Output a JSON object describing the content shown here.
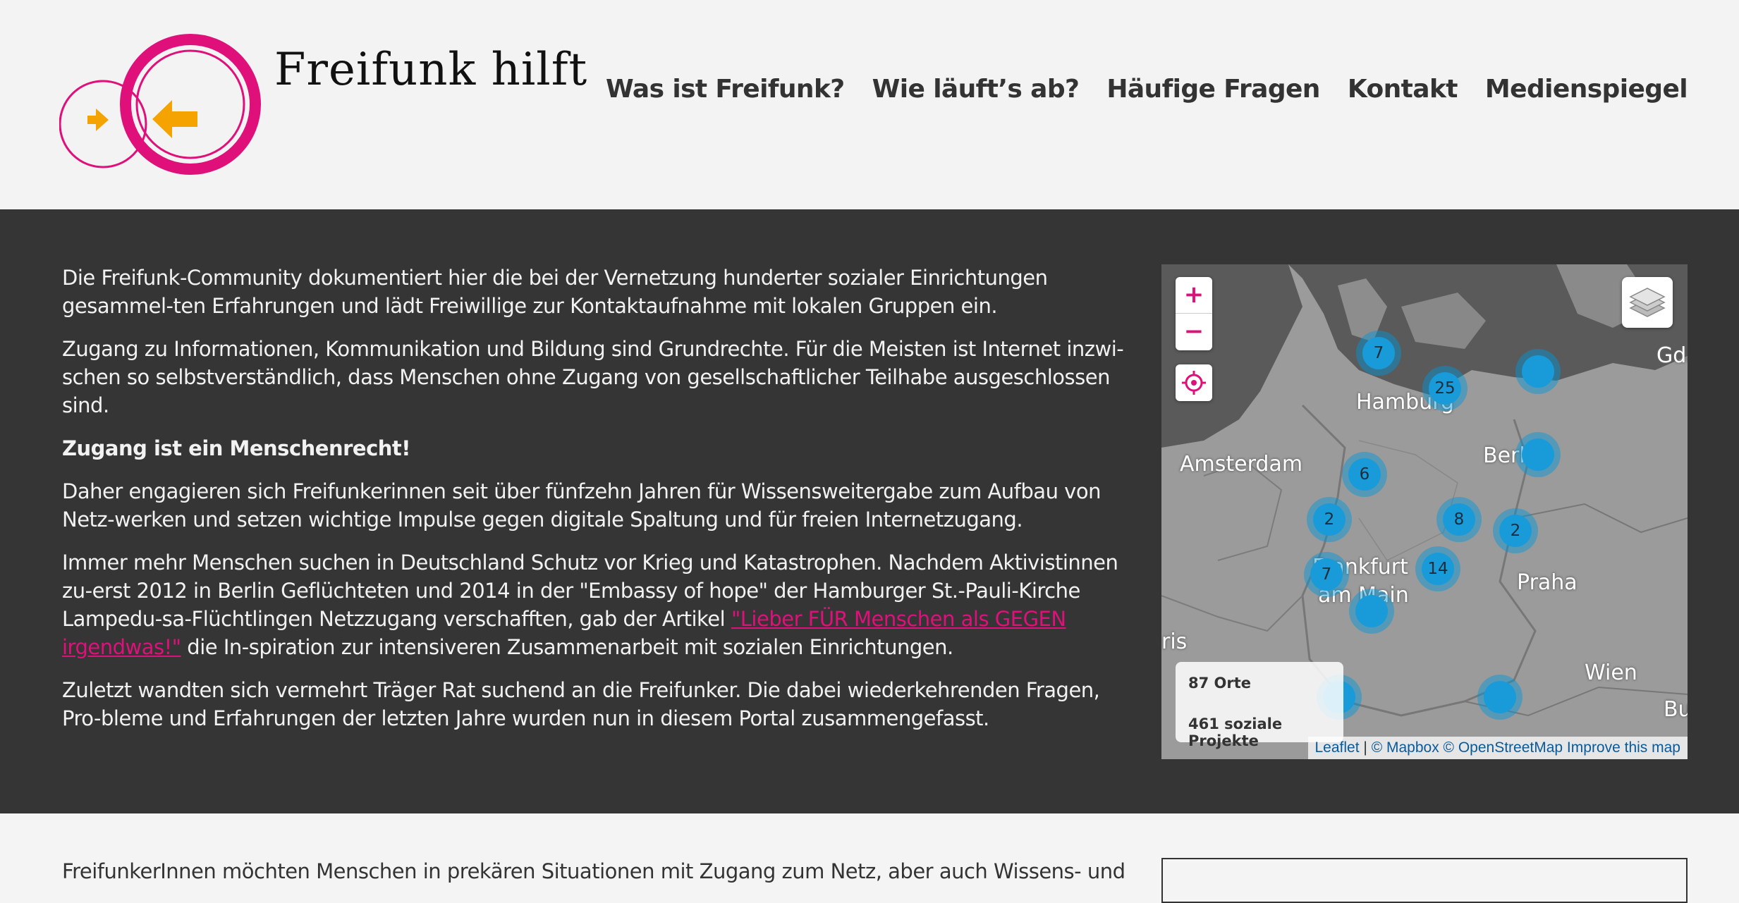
{
  "header": {
    "site_title": "Freifunk hilft",
    "nav": [
      "Was ist Freifunk?",
      "Wie läuft’s ab?",
      "Häufige Fragen",
      "Kontakt",
      "Medienspiegel"
    ]
  },
  "intro": {
    "p1": "Die Freifunk-Community dokumentiert hier die bei der Vernetzung hunderter sozialer Einrichtungen gesammel-ten Erfahrungen und lädt Freiwillige zur Kontaktaufnahme mit lokalen Gruppen ein.",
    "p2": "Zugang zu Informationen, Kommunikation und Bildung sind Grundrechte. Für die Meisten ist Internet inzwi-schen so selbstverständlich, dass Menschen ohne Zugang von gesellschaftlicher Teilhabe ausgeschlossen sind.",
    "p3": "Zugang ist ein Menschenrecht!",
    "p4": "Daher engagieren sich Freifunkerinnen seit über fünfzehn Jahren für Wissensweitergabe zum Aufbau von Netz-werken und setzen wichtige Impulse gegen digitale Spaltung und für freien Internetzugang.",
    "p5_before": "Immer mehr Menschen suchen in Deutschland Schutz vor Krieg und Katastrophen. Nachdem Aktivistinnen zu-erst 2012 in Berlin Geflüchteten und 2014 in der \"Embassy of hope\" der Hamburger St.-Pauli-Kirche Lampedu-sa-Flüchtlingen Netzzugang verschafften, gab der Artikel ",
    "p5_link": "\"Lieber FÜR Menschen als GEGEN irgendwas!\"",
    "p5_after": " die In-spiration zur intensiveren Zusammenarbeit mit sozialen Einrichtungen.",
    "p6": "Zuletzt wandten sich vermehrt Träger Rat suchend an die Freifunker. Die dabei wiederkehrenden Fragen, Pro-bleme und Erfahrungen der letzten Jahre wurden nun in diesem Portal zusammengefasst."
  },
  "map": {
    "zoom_in": "+",
    "zoom_out": "−",
    "clusters": [
      "7",
      "25",
      "",
      "",
      "6",
      "2",
      "8",
      "2",
      "7",
      "14",
      "",
      "",
      ""
    ],
    "cities": [
      "Gda",
      "Hamburg",
      "Berlin",
      "Amsterdam",
      "Frankfurt",
      "am Main",
      "Praha",
      "ris",
      "Wien",
      "Bud"
    ],
    "stats_places": "87 Orte",
    "stats_projects": "461 soziale Projekte",
    "attrib_leaflet": "Leaflet",
    "attrib_sep": " | ",
    "attrib_rest": "© Mapbox © OpenStreetMap Improve this map",
    "accent_color": "#e0107a",
    "cluster_color": "#199bd9"
  },
  "bottom": {
    "text": "FreifunkerInnen möchten Menschen in prekären Situationen mit Zugang zum Netz, aber auch Wissens- und"
  }
}
